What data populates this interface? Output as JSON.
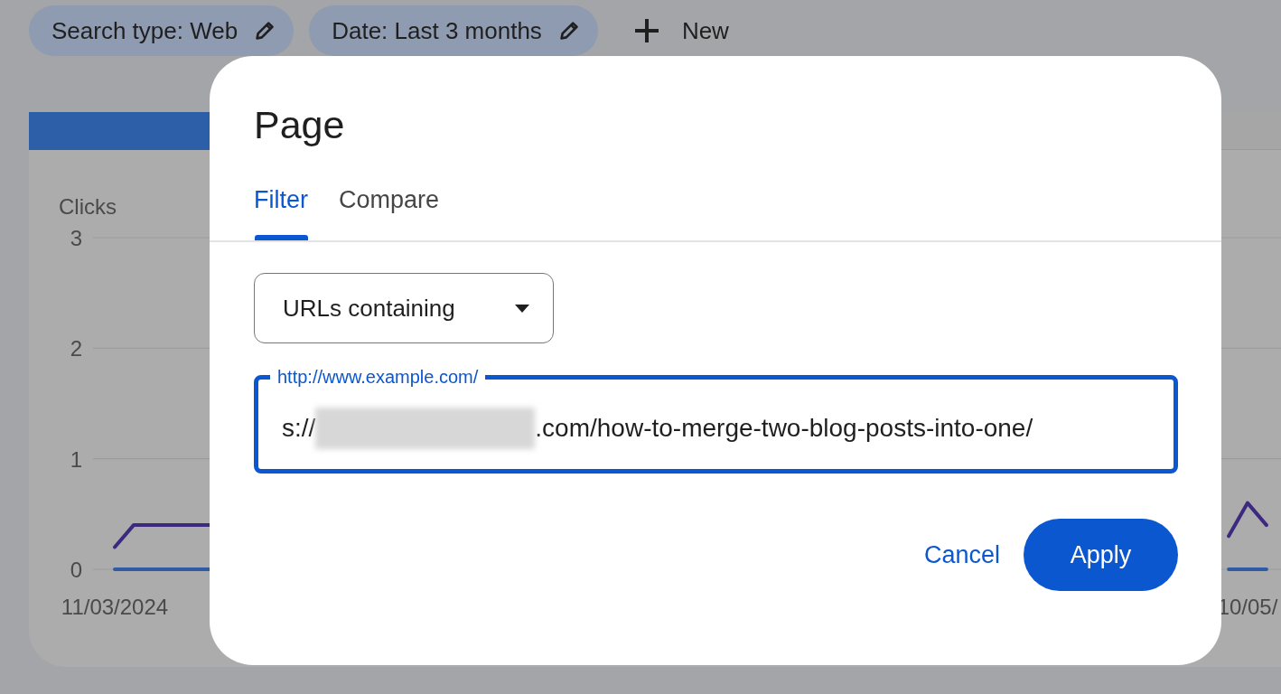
{
  "filters": [
    {
      "label": "Search type: Web"
    },
    {
      "label": "Date: Last 3 months"
    }
  ],
  "new_button": {
    "label": "New"
  },
  "performance_card": {
    "chart_data": {
      "type": "line",
      "ylabel": "Clicks",
      "categories": [
        "11/03/2024",
        null,
        null,
        null,
        null,
        null,
        null,
        null,
        null,
        null,
        null,
        null,
        null,
        null,
        null,
        null,
        null,
        null,
        null,
        null,
        null,
        null,
        null,
        null,
        null,
        null,
        null,
        null,
        null,
        null,
        null,
        null,
        null,
        null,
        null,
        null,
        null,
        null,
        null,
        null,
        null,
        null,
        null,
        null,
        null,
        null,
        null,
        null,
        null,
        null,
        null,
        null,
        null,
        null,
        null,
        null,
        null,
        null,
        null,
        null,
        "10/05/",
        null
      ],
      "ylim": [
        0,
        3
      ],
      "yticks": [
        0,
        1,
        2,
        3
      ],
      "series": [
        {
          "color": "#3d2a80",
          "values": [
            0.2,
            0.4,
            0.4,
            0.4,
            0.4,
            0.4,
            null,
            null,
            null,
            null,
            null,
            null,
            null,
            null,
            null,
            null,
            null,
            null,
            null,
            null,
            null,
            null,
            null,
            null,
            null,
            null,
            null,
            null,
            null,
            null,
            null,
            null,
            null,
            null,
            null,
            null,
            null,
            null,
            null,
            null,
            null,
            null,
            null,
            null,
            null,
            null,
            null,
            null,
            null,
            null,
            null,
            null,
            null,
            null,
            null,
            null,
            null,
            null,
            null,
            0.3,
            0.6,
            0.4
          ]
        },
        {
          "color": "#2f5ba5",
          "values": [
            0,
            0,
            0,
            0,
            0,
            0,
            null,
            null,
            null,
            null,
            null,
            null,
            null,
            null,
            null,
            null,
            null,
            null,
            null,
            null,
            null,
            null,
            null,
            null,
            null,
            null,
            null,
            null,
            null,
            null,
            null,
            null,
            null,
            null,
            null,
            null,
            null,
            null,
            null,
            null,
            null,
            null,
            null,
            null,
            null,
            null,
            null,
            null,
            null,
            null,
            null,
            null,
            null,
            null,
            null,
            null,
            null,
            null,
            null,
            0,
            0,
            0
          ]
        }
      ]
    }
  },
  "dialog": {
    "title": "Page",
    "tabs": [
      {
        "label": "Filter",
        "selected": true
      },
      {
        "label": "Compare",
        "selected": false
      }
    ],
    "dropdown": {
      "value": "URLs containing"
    },
    "url_field": {
      "label": "http://www.example.com/",
      "value_start": "s://",
      "redacted": true,
      "value_end": ".com/how-to-merge-two-blog-posts-into-one/",
      "focused": true
    },
    "actions": [
      {
        "label": "Cancel",
        "kind": "text"
      },
      {
        "label": "Apply",
        "kind": "filled"
      }
    ]
  }
}
